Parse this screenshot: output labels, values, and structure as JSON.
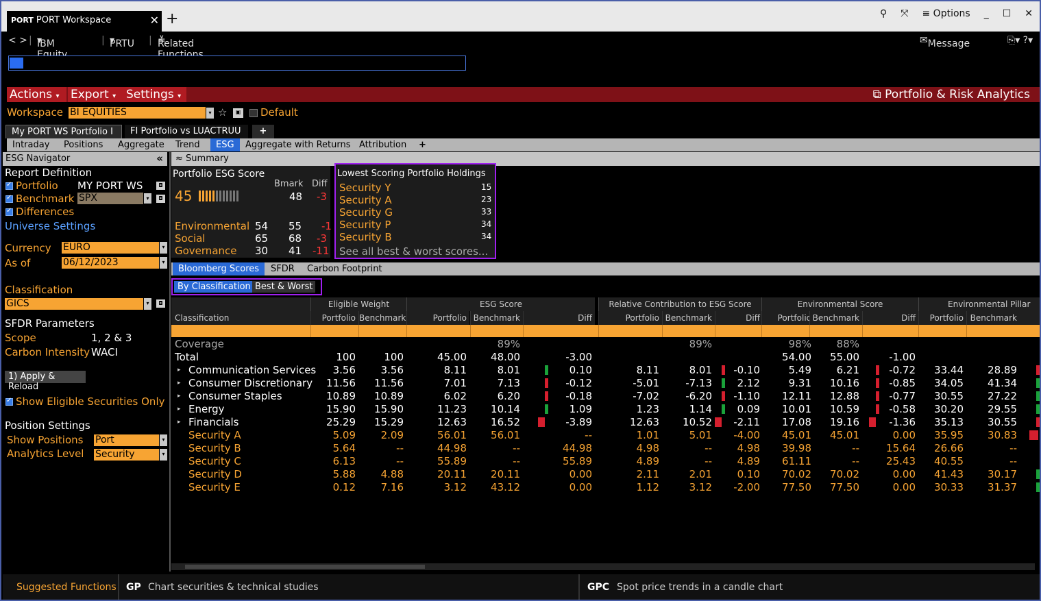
{
  "window": {
    "tab_mnemonic": "PORT",
    "tab_title": "PORT Workspace",
    "options_label": "Options"
  },
  "nav": {
    "security": "IBM Equity",
    "function": "PRTU",
    "related": "Related Functions Menu",
    "message": "Message"
  },
  "menubar": {
    "actions": "Actions",
    "export": "Export",
    "settings": "Settings",
    "app_title": "Portfolio & Risk Analytics"
  },
  "workspace": {
    "label": "Workspace",
    "value": "BI EQUITIES",
    "default_label": "Default"
  },
  "doc_tabs": [
    "My PORT WS Portfolio I",
    "FI Portfolio vs LUACTRUU"
  ],
  "sub_tabs": [
    "Intraday",
    "Positions",
    "Aggregate",
    "Trend",
    "ESG",
    "Aggregate with Returns",
    "Attribution"
  ],
  "navigator": {
    "title": "ESG Navigator",
    "report_definition": "Report Definition",
    "portfolio_label": "Portfolio",
    "portfolio_value": "MY PORT WS",
    "benchmark_label": "Benchmark",
    "benchmark_value": "SPX",
    "differences_label": "Differences",
    "universe_settings": "Universe Settings",
    "currency_label": "Currency",
    "currency_value": "EURO",
    "asof_label": "As of",
    "asof_value": "06/12/2023",
    "classification_label": "Classification",
    "classification_value": "GICS",
    "sfdr_params": "SFDR Parameters",
    "scope_label": "Scope",
    "scope_value": "1, 2 & 3",
    "carbon_label": "Carbon Intensity",
    "carbon_value": "WACI",
    "apply_button": "1) Apply & Reload",
    "show_eligible": "Show Eligible Securities Only",
    "position_settings": "Position Settings",
    "show_positions_label": "Show Positions",
    "show_positions_value": "Port",
    "analytics_label": "Analytics Level",
    "analytics_value": "Security"
  },
  "summary": {
    "header": "Summary",
    "esg_title": "Portfolio ESG Score",
    "score": "45",
    "bmark_label": "Bmark",
    "diff_label": "Diff",
    "bmark": "48",
    "diff": "-3",
    "score_fraction": 0.45,
    "pillars": [
      {
        "name": "Environmental",
        "port": "54",
        "bmark": "55",
        "diff": "-1"
      },
      {
        "name": "Social",
        "port": "65",
        "bmark": "68",
        "diff": "-3"
      },
      {
        "name": "Governance",
        "port": "30",
        "bmark": "41",
        "diff": "-11"
      }
    ],
    "lowest_title": "Lowest Scoring Portfolio Holdings",
    "lowest": [
      {
        "name": "Security Y",
        "score": "15"
      },
      {
        "name": "Security A",
        "score": "23"
      },
      {
        "name": "Security G",
        "score": "33"
      },
      {
        "name": "Security P",
        "score": "34"
      },
      {
        "name": "Security B",
        "score": "34"
      }
    ],
    "see_all": "See all best & worst scores..."
  },
  "score_tabs": [
    "Bloomberg Scores",
    "SFDR",
    "Carbon Footprint"
  ],
  "view_tabs": [
    "By Classification",
    "Best & Worst"
  ],
  "table": {
    "groups": [
      "Eligible Weight",
      "ESG Score",
      "Relative Contribution to ESG Score",
      "Environmental Score",
      "Environmental Pillar We"
    ],
    "classification_header": "Classification",
    "cols": [
      "Portfolio",
      "Benchmark",
      "Portfolio",
      "Benchmark",
      "Diff",
      "Portfolio",
      "Benchmark",
      "Diff",
      "Portfolio",
      "Benchmark",
      "Diff",
      "Portfolio",
      "Benchmark"
    ],
    "coverage": {
      "label": "Coverage",
      "esg_bm": "89%",
      "rc_bm": "89%",
      "env_p": "98%",
      "env_b": "88%"
    },
    "rows": [
      {
        "name": "Total",
        "kind": "total",
        "v": [
          "100",
          "100",
          "45.00",
          "48.00",
          "-3.00",
          "",
          "",
          "",
          "54.00",
          "55.00",
          "-1.00",
          "",
          ""
        ]
      },
      {
        "name": "Communication Services",
        "kind": "group",
        "v": [
          "3.56",
          "3.56",
          "8.11",
          "8.01",
          "0.10",
          "8.11",
          "8.01",
          "-0.10",
          "5.49",
          "6.21",
          "-0.72",
          "33.44",
          "28.89"
        ],
        "b1": "g",
        "b2": "r",
        "b3": "r",
        "b4": "r"
      },
      {
        "name": "Consumer Discretionary",
        "kind": "group",
        "v": [
          "11.56",
          "11.56",
          "7.01",
          "7.13",
          "-0.12",
          "-5.01",
          "-7.13",
          "2.12",
          "9.31",
          "10.16",
          "-0.85",
          "34.05",
          "41.34"
        ],
        "b1": "r",
        "b2": "g",
        "b3": "r",
        "b4": "g"
      },
      {
        "name": "Consumer Staples",
        "kind": "group",
        "v": [
          "10.89",
          "10.89",
          "6.02",
          "6.20",
          "-0.18",
          "-7.02",
          "-6.20",
          "-1.10",
          "12.11",
          "12.88",
          "-0.77",
          "30.55",
          "27.22"
        ],
        "b1": "r",
        "b2": "r",
        "b3": "r",
        "b4": "g"
      },
      {
        "name": "Energy",
        "kind": "group",
        "v": [
          "15.90",
          "15.90",
          "11.23",
          "10.14",
          "1.09",
          "1.23",
          "1.14",
          "0.09",
          "10.01",
          "10.59",
          "-0.58",
          "30.20",
          "29.55"
        ],
        "b1": "g",
        "b2": "g",
        "b3": "r",
        "b4": "g"
      },
      {
        "name": "Financials",
        "kind": "group",
        "v": [
          "25.29",
          "15.29",
          "12.63",
          "16.52",
          "-3.89",
          "12.63",
          "10.52",
          "-2.11",
          "17.08",
          "19.16",
          "-1.36",
          "35.13",
          "30.55"
        ],
        "b1": "R",
        "b2": "R",
        "b3": "R",
        "b4": "r"
      },
      {
        "name": "Security A",
        "kind": "sec",
        "v": [
          "5.09",
          "2.09",
          "56.01",
          "56.01",
          "--",
          "1.01",
          "5.01",
          "-4.00",
          "45.01",
          "45.01",
          "0.00",
          "35.95",
          "30.83"
        ],
        "b4": "R"
      },
      {
        "name": "Security B",
        "kind": "sec",
        "v": [
          "5.64",
          "--",
          "44.98",
          "--",
          "44.98",
          "4.98",
          "--",
          "4.98",
          "39.98",
          "--",
          "15.64",
          "26.66",
          "--"
        ]
      },
      {
        "name": "Security C",
        "kind": "sec",
        "v": [
          "6.13",
          "--",
          "55.89",
          "--",
          "55.89",
          "4.89",
          "--",
          "4.89",
          "61.11",
          "--",
          "25.43",
          "40.55",
          "--"
        ]
      },
      {
        "name": "Security D",
        "kind": "sec",
        "v": [
          "5.88",
          "4.88",
          "20.11",
          "20.11",
          "0.00",
          "2.11",
          "2.01",
          "0.10",
          "70.02",
          "70.02",
          "0.00",
          "41.43",
          "30.17"
        ],
        "b4": "g"
      },
      {
        "name": "Security E",
        "kind": "sec",
        "v": [
          "0.12",
          "7.16",
          "3.12",
          "43.12",
          "0.00",
          "1.12",
          "3.12",
          "-2.00",
          "77.50",
          "77.50",
          "0.00",
          "30.33",
          "31.37"
        ],
        "b4": "g"
      }
    ]
  },
  "footer": {
    "suggested": "Suggested Functions",
    "f1_code": "GP",
    "f1_desc": "Chart securities & technical studies",
    "f2_code": "GPC",
    "f2_desc": "Spot price trends in a candle chart"
  }
}
